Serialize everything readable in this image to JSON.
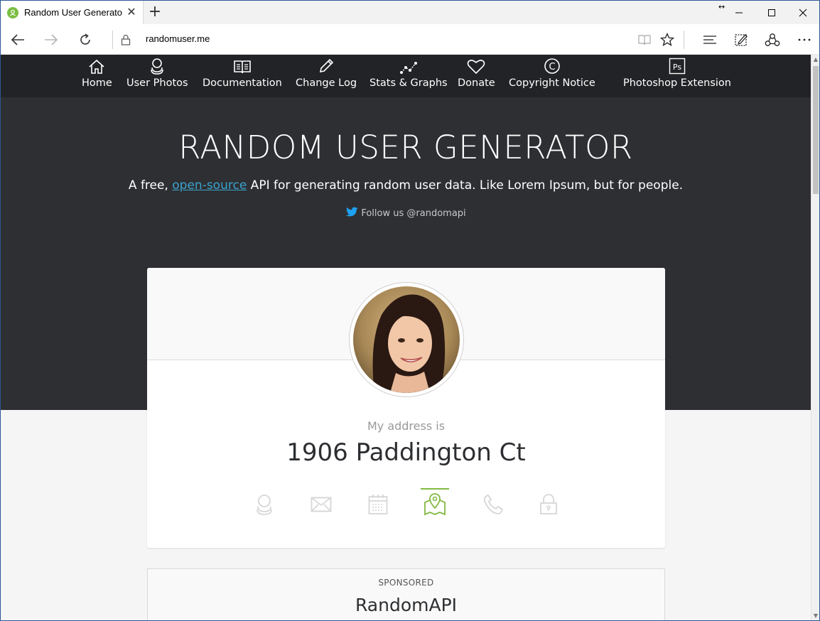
{
  "browser": {
    "tab_title": "Random User Generato",
    "url": "randomuser.me"
  },
  "site_nav": [
    {
      "label": "Home",
      "icon": "home-icon"
    },
    {
      "label": "User Photos",
      "icon": "user-icon"
    },
    {
      "label": "Documentation",
      "icon": "book-icon"
    },
    {
      "label": "Change Log",
      "icon": "pencil-icon"
    },
    {
      "label": "Stats & Graphs",
      "icon": "graph-icon"
    },
    {
      "label": "Donate",
      "icon": "heart-icon"
    },
    {
      "label": "Copyright Notice",
      "icon": "copyright-icon"
    },
    {
      "label": "Photoshop Extension",
      "icon": "photoshop-icon"
    }
  ],
  "hero": {
    "title": "RANDOM USER GENERATOR",
    "sub_before": "A free, ",
    "sub_link": "open-source",
    "sub_after": " API for generating random user data. Like Lorem Ipsum, but for people.",
    "follow": "Follow us @randomapi"
  },
  "card": {
    "label": "My address is",
    "value": "1906 Paddington Ct",
    "active_tab": "location",
    "accent_color": "#83ba43"
  },
  "sponsor": {
    "label": "SPONSORED",
    "title": "RandomAPI"
  }
}
